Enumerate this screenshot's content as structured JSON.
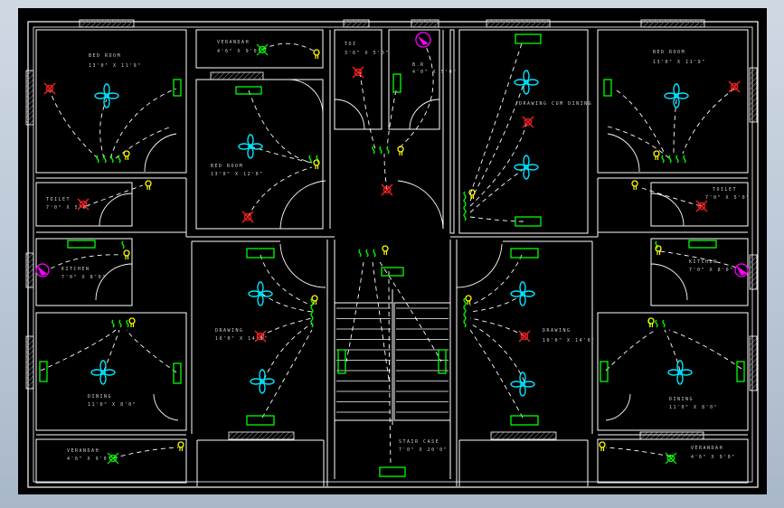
{
  "drawing": {
    "kind": "electrical floor plan",
    "colors": {
      "background": "#000000",
      "walls": "#ffffff",
      "wiring": "#ffffff",
      "switch_board": "#00ff00",
      "fan": "#00e5ff",
      "light": "#ff2020",
      "outlet": "#ffff00",
      "db_panel": "#ff00ff",
      "hatch": "#9a9a9a"
    },
    "rooms": [
      {
        "name": "BED ROOM",
        "size": "13'0\" X 11'9\""
      },
      {
        "name": "VERANDAH",
        "size": "4'6\" X 9'0\""
      },
      {
        "name": "TOI",
        "size": "3'6\" X 5'0\""
      },
      {
        "name": "B.R",
        "size": "4'0\" X 5'0\""
      },
      {
        "name": "BED ROOM",
        "size": "13'0\" X 12'0\""
      },
      {
        "name": "DRAWING CUM DINING",
        "size": ""
      },
      {
        "name": "BED ROOM",
        "size": "13'0\" X 11'9\""
      },
      {
        "name": "TOILET",
        "size": "7'0\" X 5'0\""
      },
      {
        "name": "TOILET",
        "size": "7'0\" X 5'0\""
      },
      {
        "name": "KITCHEN",
        "size": "7'0\" X 8'0\""
      },
      {
        "name": "KITCHEN",
        "size": "7'0\" X 8'0\""
      },
      {
        "name": "DRAWING",
        "size": "10'0\" X 14'0\""
      },
      {
        "name": "DRAWING",
        "size": "10'0\" X 14'0\""
      },
      {
        "name": "DINING",
        "size": "11'0\" X 8'0\""
      },
      {
        "name": "DINING",
        "size": "11'0\" X 8'0\""
      },
      {
        "name": "VERANDAH",
        "size": "4'6\" X 9'0\""
      },
      {
        "name": "VERANDAH",
        "size": "4'6\" X 9'0\""
      },
      {
        "name": "STAIR CASE",
        "size": "7'0\" X 20'0\""
      }
    ]
  }
}
